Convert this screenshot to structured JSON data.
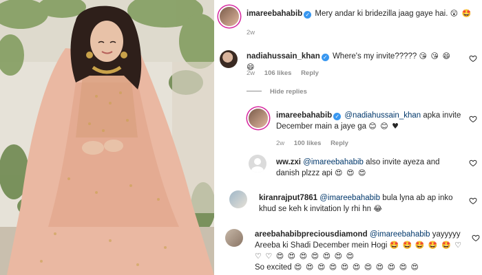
{
  "comments": [
    {
      "username": "imareebahabib",
      "verified": true,
      "text": "Mery andar ki bridezilla jaag gaye hai.",
      "emojis": "😲 🤩",
      "time": "2w"
    },
    {
      "username": "nadiahussain_khan",
      "verified": true,
      "text": "Where's my invite?????",
      "emojis": "😘 😘 😄 😄",
      "time": "2w",
      "likes": "106 likes",
      "reply_label": "Reply"
    },
    {
      "username": "imareebahabib",
      "verified": true,
      "mention": "@nadiahussain_khan",
      "text": "apka invite December main a jaye ga",
      "emojis": "😊 😊 ♥",
      "time": "2w",
      "likes": "100 likes",
      "reply_label": "Reply"
    },
    {
      "username": "ww.zxi",
      "mention": "@imareebahabib",
      "text": "also invite ayeza and danish plzzz api",
      "emojis": "😍 😍 😍"
    },
    {
      "username": "kiranrajput7861",
      "mention": "@imareebahabib",
      "text": "bula lyna ab ap inko khud se keh k invitation ly rhi hn",
      "emojis": "😂"
    },
    {
      "username": "areebahabibpreciousdiamond",
      "mention": "@imareebahabib",
      "text": "yayyyyy Areeba ki Shadi December mein Hogi",
      "emojis_line1": "🤩 🤩",
      "emojis_line2": "🤩 🤩 🤩 ♡ ♡ ♡ 😍 😍 😍 😍 😍 😍 😍",
      "text2": "So excited",
      "emojis_line3": "😍 😍 😍 😍 😍 😍 😍 😍 😍 😍 😍"
    }
  ],
  "hide_replies_label": "Hide replies",
  "colors": {
    "verified": "#3897f0",
    "mention": "#00376b",
    "muted": "#8e8e8e",
    "dress": "#e9b9a4"
  }
}
